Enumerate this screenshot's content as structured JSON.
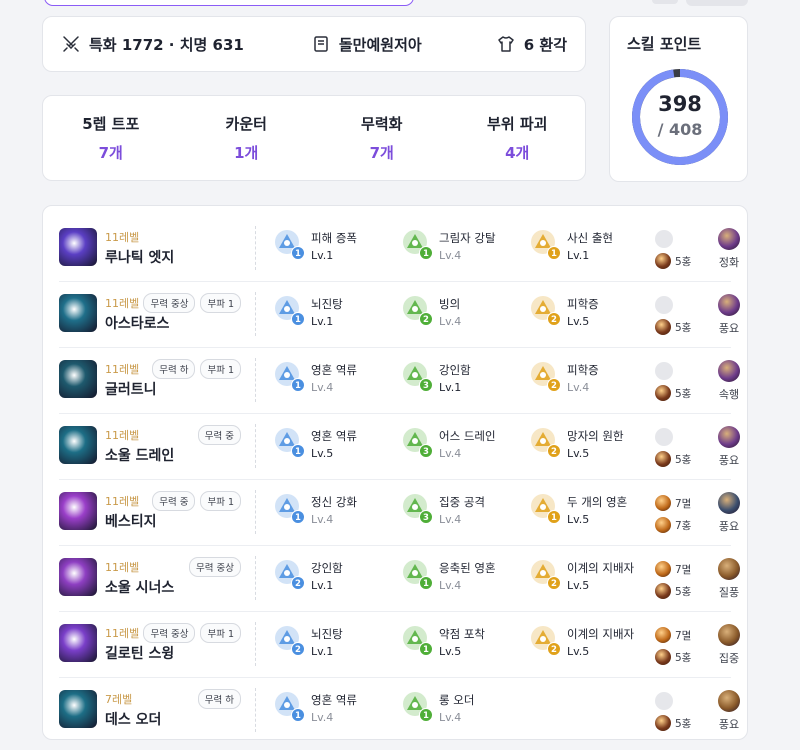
{
  "info": {
    "stats_text": "특화 1772 · 치명 631",
    "engraving_text": "돌만예원저아",
    "costume_text": "6 환각"
  },
  "counts": [
    {
      "label": "5렙 트포",
      "value": "7개"
    },
    {
      "label": "카운터",
      "value": "1개"
    },
    {
      "label": "무력화",
      "value": "7개"
    },
    {
      "label": "부위 파괴",
      "value": "4개"
    }
  ],
  "skill_points": {
    "title": "스킬 포인트",
    "used": "398",
    "total": "/ 408",
    "fraction": 0.9755,
    "ring_color": "#7b8ff7",
    "remain_color": "#3a3d46"
  },
  "colors": {
    "accent": "#7c4ddb",
    "level_text": "#c99a4a",
    "tripod_blue": "#4a8fe0",
    "tripod_green": "#4fae38",
    "tripod_gold": "#e0a11a"
  },
  "skills": [
    {
      "level": "11레벨",
      "name": "루나틱 엣지",
      "tags": [],
      "icon": "lunatic-edge-icon",
      "icon_color": "#5b3fc4",
      "tripods": [
        {
          "name": "피해 증폭",
          "lv": "Lv.1",
          "slot": "1",
          "color": "blue",
          "icon": "damage-amp-icon"
        },
        {
          "name": "그림자 강탈",
          "lv": "Lv.4",
          "slot": "1",
          "color": "green",
          "icon": "shadow-steal-icon"
        },
        {
          "name": "사신 출현",
          "lv": "Lv.1",
          "slot": "1",
          "color": "gold",
          "icon": "reaper-appear-icon"
        }
      ],
      "gems": [
        {
          "text": "",
          "kind": "empty"
        },
        {
          "text": "5홍",
          "kind": "ruby"
        }
      ],
      "rune": {
        "name": "정화",
        "icon": "purify-rune-icon",
        "color": "#6e3c8a"
      }
    },
    {
      "level": "11레벨",
      "name": "아스타로스",
      "tags": [
        "무력 중상",
        "부파 1"
      ],
      "icon": "astaroth-icon",
      "icon_color": "#1f6f8a",
      "tripods": [
        {
          "name": "뇌진탕",
          "lv": "Lv.1",
          "slot": "1",
          "color": "blue",
          "icon": "concussion-icon"
        },
        {
          "name": "빙의",
          "lv": "Lv.4",
          "slot": "2",
          "color": "green",
          "icon": "possession-icon"
        },
        {
          "name": "피학증",
          "lv": "Lv.5",
          "slot": "2",
          "color": "gold",
          "icon": "masochism-icon"
        }
      ],
      "gems": [
        {
          "text": "",
          "kind": "empty"
        },
        {
          "text": "5홍",
          "kind": "ruby"
        }
      ],
      "rune": {
        "name": "풍요",
        "icon": "abundance-rune-icon",
        "color": "#6e3c8a"
      }
    },
    {
      "level": "11레벨",
      "name": "글러트니",
      "tags": [
        "무력 하",
        "부파 1"
      ],
      "icon": "gluttony-icon",
      "icon_color": "#1e5a6e",
      "tripods": [
        {
          "name": "영혼 역류",
          "lv": "Lv.4",
          "slot": "1",
          "color": "blue",
          "icon": "soul-reflux-icon"
        },
        {
          "name": "강인함",
          "lv": "Lv.1",
          "slot": "3",
          "color": "green",
          "icon": "toughness-icon"
        },
        {
          "name": "피학증",
          "lv": "Lv.4",
          "slot": "2",
          "color": "gold",
          "icon": "masochism-icon"
        }
      ],
      "gems": [
        {
          "text": "",
          "kind": "empty"
        },
        {
          "text": "5홍",
          "kind": "ruby"
        }
      ],
      "rune": {
        "name": "속행",
        "icon": "haste-rune-icon",
        "color": "#6e3c8a"
      }
    },
    {
      "level": "11레벨",
      "name": "소울 드레인",
      "tags": [
        "무력 중"
      ],
      "icon": "soul-drain-icon",
      "icon_color": "#1d6e86",
      "tripods": [
        {
          "name": "영혼 역류",
          "lv": "Lv.5",
          "slot": "1",
          "color": "blue",
          "icon": "soul-reflux-icon"
        },
        {
          "name": "어스 드레인",
          "lv": "Lv.4",
          "slot": "3",
          "color": "green",
          "icon": "earth-drain-icon"
        },
        {
          "name": "망자의 원한",
          "lv": "Lv.5",
          "slot": "2",
          "color": "gold",
          "icon": "grudge-icon"
        }
      ],
      "gems": [
        {
          "text": "",
          "kind": "empty"
        },
        {
          "text": "5홍",
          "kind": "ruby"
        }
      ],
      "rune": {
        "name": "풍요",
        "icon": "abundance-rune-icon",
        "color": "#6e3c8a"
      }
    },
    {
      "level": "11레벨",
      "name": "베스티지",
      "tags": [
        "무력 중",
        "부파 1"
      ],
      "icon": "vestige-icon",
      "icon_color": "#9a3fc9",
      "tripods": [
        {
          "name": "정신 강화",
          "lv": "Lv.4",
          "slot": "1",
          "color": "blue",
          "icon": "mind-enhance-icon"
        },
        {
          "name": "집중 공격",
          "lv": "Lv.4",
          "slot": "3",
          "color": "green",
          "icon": "focus-attack-icon"
        },
        {
          "name": "두 개의 영혼",
          "lv": "Lv.5",
          "slot": "1",
          "color": "gold",
          "icon": "two-souls-icon"
        }
      ],
      "gems": [
        {
          "text": "7멸",
          "kind": "amber"
        },
        {
          "text": "7홍",
          "kind": "amber"
        }
      ],
      "rune": {
        "name": "풍요",
        "icon": "abundance-rune-icon",
        "color": "#3b4e6e"
      }
    },
    {
      "level": "11레벨",
      "name": "소울 시너스",
      "tags": [
        "무력 중상"
      ],
      "icon": "soul-sinners-icon",
      "icon_color": "#8e3fc2",
      "tripods": [
        {
          "name": "강인함",
          "lv": "Lv.1",
          "slot": "2",
          "color": "blue",
          "icon": "toughness-icon"
        },
        {
          "name": "응축된 영혼",
          "lv": "Lv.4",
          "slot": "1",
          "color": "green",
          "icon": "condensed-soul-icon"
        },
        {
          "name": "이계의 지배자",
          "lv": "Lv.5",
          "slot": "2",
          "color": "gold",
          "icon": "otherworld-ruler-icon"
        }
      ],
      "gems": [
        {
          "text": "7멸",
          "kind": "amber"
        },
        {
          "text": "5홍",
          "kind": "ruby"
        }
      ],
      "rune": {
        "name": "질풍",
        "icon": "gale-rune-icon",
        "color": "#8a5a2a"
      }
    },
    {
      "level": "11레벨",
      "name": "길로틴 스윙",
      "tags": [
        "무력 중상",
        "부파 1"
      ],
      "icon": "guillotine-swing-icon",
      "icon_color": "#7a3fc9",
      "tripods": [
        {
          "name": "뇌진탕",
          "lv": "Lv.1",
          "slot": "2",
          "color": "blue",
          "icon": "concussion-icon"
        },
        {
          "name": "약점 포착",
          "lv": "Lv.5",
          "slot": "1",
          "color": "green",
          "icon": "weak-point-icon"
        },
        {
          "name": "이계의 지배자",
          "lv": "Lv.5",
          "slot": "2",
          "color": "gold",
          "icon": "otherworld-ruler-icon"
        }
      ],
      "gems": [
        {
          "text": "7멸",
          "kind": "amber"
        },
        {
          "text": "5홍",
          "kind": "ruby"
        }
      ],
      "rune": {
        "name": "집중",
        "icon": "focus-rune-icon",
        "color": "#8a5a2a"
      }
    },
    {
      "level": "7레벨",
      "name": "데스 오더",
      "tags": [
        "무력 하"
      ],
      "icon": "death-order-icon",
      "icon_color": "#1d6e86",
      "tripods": [
        {
          "name": "영혼 역류",
          "lv": "Lv.4",
          "slot": "1",
          "color": "blue",
          "icon": "soul-reflux-icon"
        },
        {
          "name": "롱 오더",
          "lv": "Lv.4",
          "slot": "1",
          "color": "green",
          "icon": "long-order-icon"
        }
      ],
      "gems": [
        {
          "text": "",
          "kind": "empty"
        },
        {
          "text": "5홍",
          "kind": "ruby"
        }
      ],
      "rune": {
        "name": "풍요",
        "icon": "abundance-rune-icon",
        "color": "#8a5a2a"
      }
    }
  ]
}
